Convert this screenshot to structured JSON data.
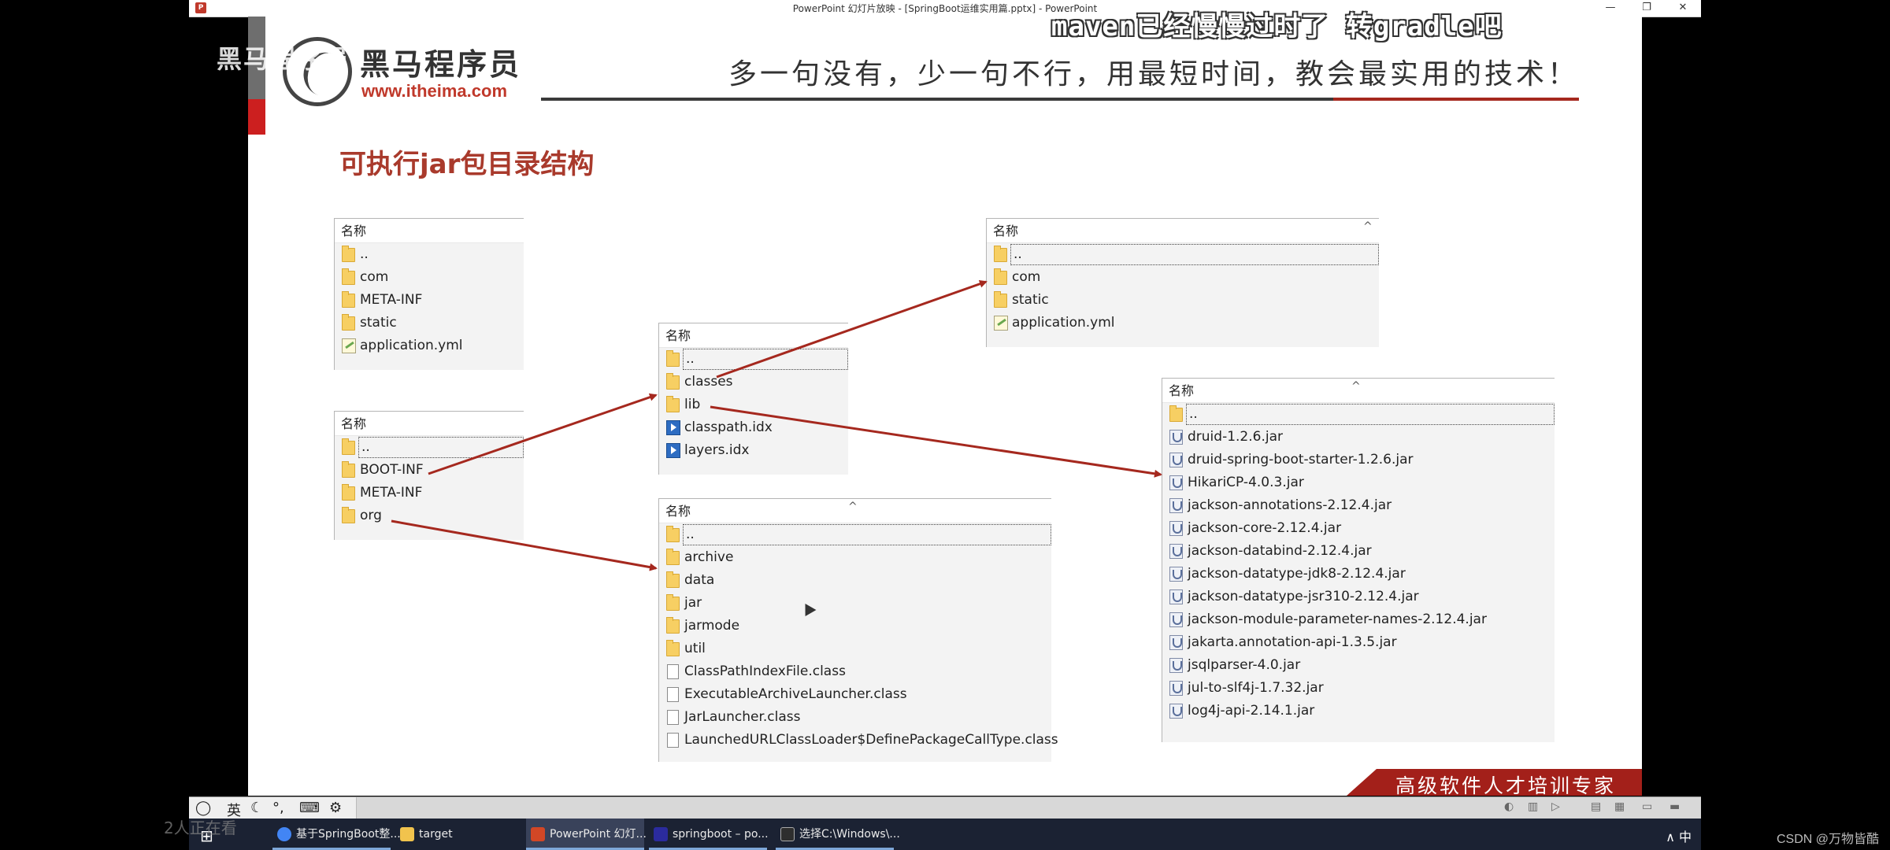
{
  "window": {
    "title": "PowerPoint 幻灯片放映 - [SpringBoot运维实用篇.pptx] - PowerPoint",
    "min_glyph": "—",
    "restore_glyph": "❐",
    "close_glyph": "✕"
  },
  "slide": {
    "logo_name": "黑马程序员",
    "logo_url": "www.itheima.com",
    "header_slogan": "多一句没有，少一句不行，用最短时间，教会最实用的技术！",
    "title": "可执行jar包目录结构",
    "footer_banner": "高级软件人才培训专家"
  },
  "panels": {
    "root": {
      "header": "名称",
      "items": [
        {
          "name": "..",
          "icon": "folder"
        },
        {
          "name": "com",
          "icon": "folder"
        },
        {
          "name": "META-INF",
          "icon": "folder"
        },
        {
          "name": "static",
          "icon": "folder"
        },
        {
          "name": "application.yml",
          "icon": "yml"
        }
      ]
    },
    "jar_root": {
      "header": "名称",
      "items": [
        {
          "name": "..",
          "icon": "folder"
        },
        {
          "name": "BOOT-INF",
          "icon": "folder"
        },
        {
          "name": "META-INF",
          "icon": "folder"
        },
        {
          "name": "org",
          "icon": "folder"
        }
      ]
    },
    "boot_inf": {
      "header": "名称",
      "items": [
        {
          "name": "..",
          "icon": "folder"
        },
        {
          "name": "classes",
          "icon": "folder"
        },
        {
          "name": "lib",
          "icon": "folder"
        },
        {
          "name": "classpath.idx",
          "icon": "idx"
        },
        {
          "name": "layers.idx",
          "icon": "idx"
        }
      ]
    },
    "classes": {
      "header": "名称",
      "items": [
        {
          "name": "..",
          "icon": "folder"
        },
        {
          "name": "com",
          "icon": "folder"
        },
        {
          "name": "static",
          "icon": "folder"
        },
        {
          "name": "application.yml",
          "icon": "yml"
        }
      ]
    },
    "loader": {
      "header": "名称",
      "items": [
        {
          "name": "..",
          "icon": "folder"
        },
        {
          "name": "archive",
          "icon": "folder"
        },
        {
          "name": "data",
          "icon": "folder"
        },
        {
          "name": "jar",
          "icon": "folder"
        },
        {
          "name": "jarmode",
          "icon": "folder"
        },
        {
          "name": "util",
          "icon": "folder"
        },
        {
          "name": "ClassPathIndexFile.class",
          "icon": "file"
        },
        {
          "name": "ExecutableArchiveLauncher.class",
          "icon": "file"
        },
        {
          "name": "JarLauncher.class",
          "icon": "file"
        },
        {
          "name": "LaunchedURLClassLoader$DefinePackageCallType.class",
          "icon": "file"
        }
      ]
    },
    "lib": {
      "header": "名称",
      "items": [
        {
          "name": "..",
          "icon": "folder"
        },
        {
          "name": "druid-1.2.6.jar",
          "icon": "jar"
        },
        {
          "name": "druid-spring-boot-starter-1.2.6.jar",
          "icon": "jar"
        },
        {
          "name": "HikariCP-4.0.3.jar",
          "icon": "jar"
        },
        {
          "name": "jackson-annotations-2.12.4.jar",
          "icon": "jar"
        },
        {
          "name": "jackson-core-2.12.4.jar",
          "icon": "jar"
        },
        {
          "name": "jackson-databind-2.12.4.jar",
          "icon": "jar"
        },
        {
          "name": "jackson-datatype-jdk8-2.12.4.jar",
          "icon": "jar"
        },
        {
          "name": "jackson-datatype-jsr310-2.12.4.jar",
          "icon": "jar"
        },
        {
          "name": "jackson-module-parameter-names-2.12.4.jar",
          "icon": "jar"
        },
        {
          "name": "jakarta.annotation-api-1.3.5.jar",
          "icon": "jar"
        },
        {
          "name": "jsqlparser-4.0.jar",
          "icon": "jar"
        },
        {
          "name": "jul-to-slf4j-1.7.32.jar",
          "icon": "jar"
        },
        {
          "name": "log4j-api-2.14.1.jar",
          "icon": "jar"
        }
      ]
    }
  },
  "overlay": {
    "watermark": "黑马程序员",
    "danmaku": "maven已经慢慢过时了 转gradle吧",
    "viewers": "2人正在看"
  },
  "ime": {
    "lang": "英",
    "moon": "☾",
    "punct": "°,",
    "keyboard": "⌨",
    "settings": "⚙"
  },
  "status_icons": [
    "◐",
    "▥",
    "▷",
    "▤",
    "▦",
    "▭",
    "▬"
  ],
  "taskbar": {
    "start_glyph": "⊞",
    "items": [
      {
        "label": "基于SpringBoot整...",
        "color": "#4285f4"
      },
      {
        "label": "target",
        "color": "#f1c34d"
      },
      {
        "label": "PowerPoint 幻灯...",
        "color": "#d24726"
      },
      {
        "label": "springboot – po...",
        "color": "#2b2b9e"
      },
      {
        "label": "选择C:\\Windows\\...",
        "color": "#2e2e2e"
      }
    ],
    "tray": "∧  中"
  },
  "csdn": "CSDN @万物皆酷",
  "colors": {
    "title_red": "#a93a2c",
    "arrow_red": "#a5281e",
    "banner_red": "#a3201a"
  }
}
